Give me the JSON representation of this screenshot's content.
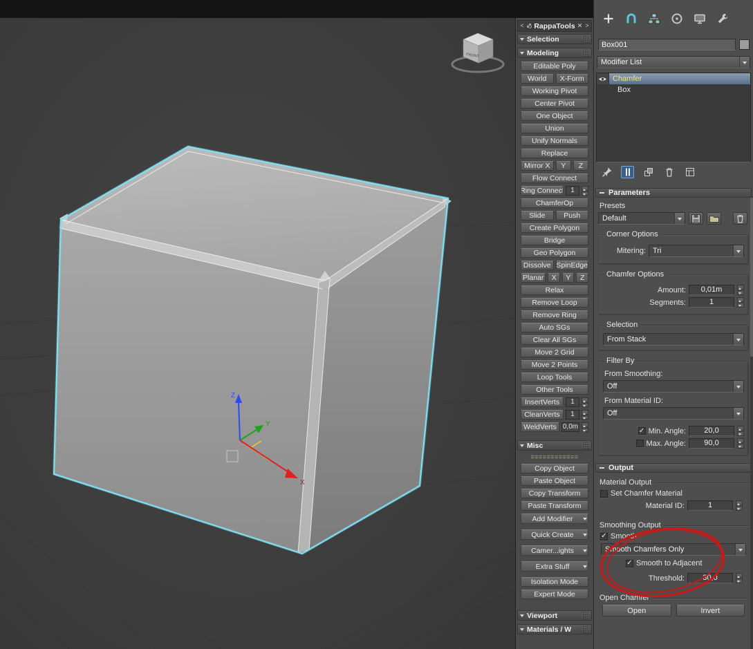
{
  "glyphs": {
    "check": "✓",
    "close": "✕",
    "chevron_left": "<",
    "chevron_right": ">"
  },
  "colors": {
    "selection_outline": "#7fe0f2",
    "modifier_highlight": "#6a80a0",
    "modifier_text": "#efe679",
    "annotation": "#c41b1b",
    "active_tool": "#3c5f86"
  },
  "viewport": {
    "viewcube_front": "FRONT",
    "axis_x": "X",
    "axis_y": "Y",
    "axis_z": "Z"
  },
  "rappatools": {
    "title": "RappaTools",
    "selection_header": "Selection",
    "modeling_header": "Modeling",
    "misc_header": "Misc",
    "viewport_header": "Viewport",
    "materials_header": "Materials / W",
    "buttons": {
      "editable_poly": "Editable Poly",
      "world": "World",
      "xform": "X-Form",
      "working_pivot": "Working Pivot",
      "center_pivot": "Center Pivot",
      "one_object": "One Object",
      "union": "Union",
      "unify_normals": "Unify Normals",
      "replace": "Replace",
      "mirror_x": "Mirror X",
      "mirror_y": "Y",
      "mirror_z": "Z",
      "flow_connect": "Flow Connect",
      "ring_connect": "Ring Connect",
      "ring_connect_value": "1",
      "chamferop": "ChamferOp",
      "slide": "Slide",
      "push": "Push",
      "create_polygon": "Create Polygon",
      "bridge": "Bridge",
      "geo_polygon": "Geo Polygon",
      "dissolve": "Dissolve",
      "spinedge": "SpinEdge",
      "planar": "Planar",
      "planar_x": "X",
      "planar_y": "Y",
      "planar_z": "Z",
      "relax": "Relax",
      "remove_loop": "Remove Loop",
      "remove_ring": "Remove Ring",
      "auto_sgs": "Auto SGs",
      "clear_all_sgs": "Clear All SGs",
      "move_2_grid": "Move 2 Grid",
      "move_2_points": "Move 2 Points",
      "loop_tools": "Loop Tools",
      "other_tools": "Other Tools",
      "insertverts": "InsertVerts",
      "insertverts_value": "1",
      "cleanverts": "CleanVerts",
      "cleanverts_value": "1",
      "weldverts": "WeldVerts",
      "weldverts_value": "0,0m"
    },
    "misc": {
      "divider": "============",
      "copy_object": "Copy Object",
      "paste_object": "Paste Object",
      "copy_transform": "Copy Transform",
      "paste_transform": "Paste Transform",
      "add_modifier": "Add Modifier",
      "quick_create": "Quick Create",
      "camera_lights": "Camer...ights",
      "extra_stuff": "Extra Stuff",
      "isolation_mode": "Isolation Mode",
      "expert_mode": "Expert Mode"
    }
  },
  "command_panel": {
    "object_name": "Box001",
    "modifier_list": "Modifier List",
    "stack_modifier": "Chamfer",
    "stack_base": "Box",
    "parameters_header": "Parameters",
    "presets_label": "Presets",
    "preset_value": "Default",
    "corner_options_title": "Corner Options",
    "mitering_label": "Mitering:",
    "mitering_value": "Tri",
    "chamfer_options_title": "Chamfer Options",
    "amount_label": "Amount:",
    "amount_value": "0,01m",
    "segments_label": "Segments:",
    "segments_value": "1",
    "selection_title": "Selection",
    "selection_value": "From Stack",
    "filter_by_title": "Filter By",
    "from_smoothing_label": "From Smoothing:",
    "from_smoothing_value": "Off",
    "from_material_label": "From Material ID:",
    "from_material_value": "Off",
    "min_angle_label": "Min. Angle:",
    "min_angle_value": "20,0",
    "max_angle_label": "Max. Angle:",
    "max_angle_value": "90,0",
    "output_header": "Output",
    "material_output_label": "Material Output",
    "set_chamfer_material_label": "Set Chamfer Material",
    "material_id_label": "Material ID:",
    "material_id_value": "1",
    "smoothing_output_label": "Smoothing Output",
    "smooth_label": "Smooth",
    "smooth_mode_value": "Smooth Chamfers Only",
    "smooth_to_adjacent_label": "Smooth to Adjacent",
    "threshold_label": "Threshold:",
    "threshold_value": "30,0",
    "open_chamfer_title": "Open Chamfer",
    "open_button": "Open",
    "invert_button": "Invert"
  }
}
